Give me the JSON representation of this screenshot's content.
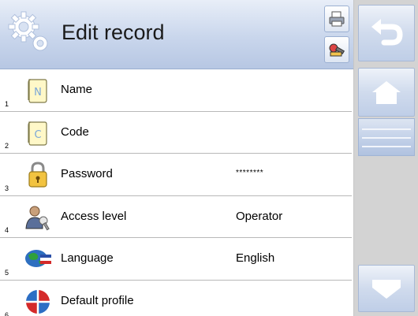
{
  "header": {
    "title": "Edit record",
    "gear_icon": "gear-icon",
    "print_icon": "printer-icon",
    "tools_icon": "tools-icon"
  },
  "rows": [
    {
      "num": "1",
      "icon": "name-icon",
      "label": "Name",
      "value": ""
    },
    {
      "num": "2",
      "icon": "code-icon",
      "label": "Code",
      "value": ""
    },
    {
      "num": "3",
      "icon": "padlock-icon",
      "label": "Password",
      "value": "********"
    },
    {
      "num": "4",
      "icon": "user-access-icon",
      "label": "Access level",
      "value": "Operator"
    },
    {
      "num": "5",
      "icon": "globe-icon",
      "label": "Language",
      "value": "English"
    },
    {
      "num": "6",
      "icon": "default-profile-icon",
      "label": "Default profile",
      "value": ""
    }
  ],
  "sidebar": {
    "back_icon": "back-arrow-icon",
    "home_icon": "home-icon",
    "down_icon": "down-arrow-icon"
  },
  "colors": {
    "header_bg": "#c9d6ec",
    "panel_bg": "#d3d3d3",
    "button_bg": "#d0dbed",
    "row_divider": "#b8b8b8"
  }
}
